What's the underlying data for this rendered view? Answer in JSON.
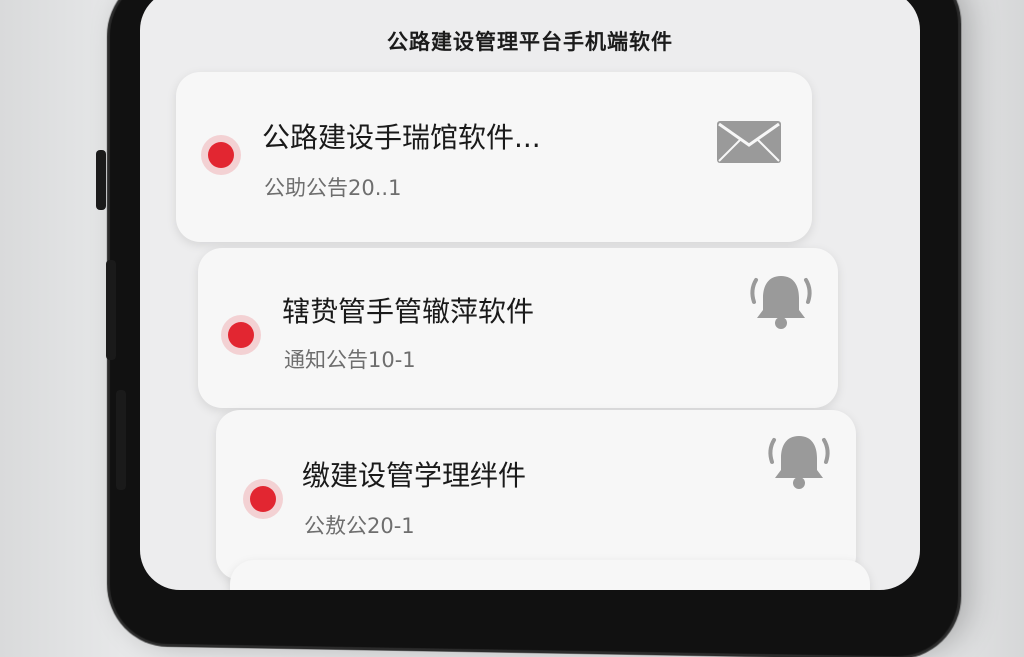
{
  "header": {
    "title": "公路建设管理平台手机端软件"
  },
  "notifications": [
    {
      "heading": "公路建设手瑞馆软件...",
      "subtext": "公助公告20..1",
      "icon": "envelope-icon",
      "unread": true
    },
    {
      "heading": "辖贽管手管辙萍软件",
      "subtext": "通知公告10-1",
      "icon": "bell-icon",
      "unread": true
    },
    {
      "heading": "缴建设管学理绊件",
      "subtext": "公敖公20-1",
      "icon": "bell-icon",
      "unread": true
    }
  ],
  "colors": {
    "unread_dot": "#e22631",
    "icon_gray": "#9a9a9a",
    "card_bg": "#f7f7f7",
    "screen_bg": "#ededee"
  }
}
